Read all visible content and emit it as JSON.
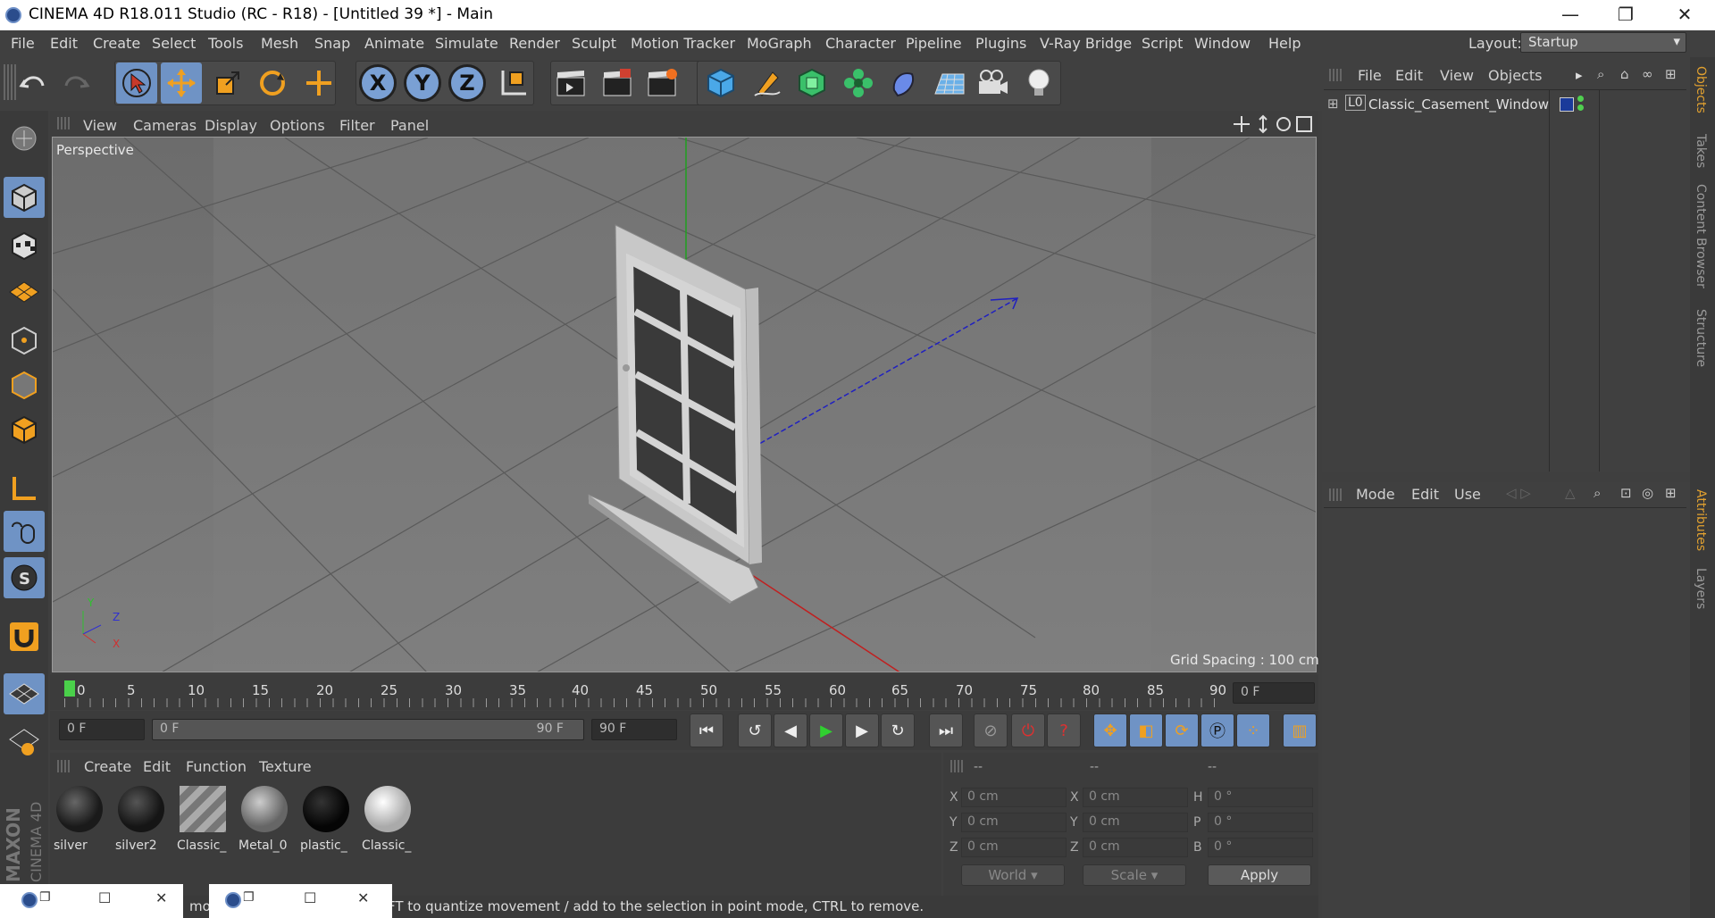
{
  "titlebar": {
    "title": "CINEMA 4D R18.011 Studio (RC - R18) - [Untitled 39 *] - Main",
    "min": "—",
    "max": "❐",
    "close": "✕"
  },
  "menubar": {
    "items": [
      "File",
      "Edit",
      "Create",
      "Select",
      "Tools",
      "Mesh",
      "Snap",
      "Animate",
      "Simulate",
      "Render",
      "Sculpt",
      "Motion Tracker",
      "MoGraph",
      "Character",
      "Pipeline",
      "Plugins",
      "V-Ray Bridge",
      "Script",
      "Window",
      "Help"
    ],
    "layout_label": "Layout:",
    "layout_value": "Startup"
  },
  "toolbar": {
    "x_label": "X",
    "y_label": "Y",
    "z_label": "Z"
  },
  "viewport": {
    "menu": [
      "View",
      "Cameras",
      "Display",
      "Options",
      "Filter",
      "Panel"
    ],
    "camera_label": "Perspective",
    "grid_spacing": "Grid Spacing : 100 cm",
    "axis_y": "Y",
    "axis_z": "Z",
    "axis_x": "X"
  },
  "timeline": {
    "ticks": [
      "0",
      "5",
      "10",
      "15",
      "20",
      "25",
      "30",
      "35",
      "40",
      "45",
      "50",
      "55",
      "60",
      "65",
      "70",
      "75",
      "80",
      "85",
      "90"
    ],
    "current_frame": "0 F",
    "start_frame": "0 F",
    "range_start": "0 F",
    "range_end": "90 F",
    "end_frame": "90 F"
  },
  "materials": {
    "menu": [
      "Create",
      "Edit",
      "Function",
      "Texture"
    ],
    "items": [
      {
        "name": "silver",
        "color": "#1a1a1a"
      },
      {
        "name": "silver2",
        "color": "#151515"
      },
      {
        "name": "Classic_",
        "color": "stripes"
      },
      {
        "name": "Metal_0",
        "color": "#8a8a8a"
      },
      {
        "name": "plastic_",
        "color": "#050505"
      },
      {
        "name": "Classic_",
        "color": "#d8d8d8"
      }
    ]
  },
  "coordinates": {
    "header": [
      "--",
      "--",
      "--"
    ],
    "rows": [
      {
        "pl": "X",
        "pv": "0 cm",
        "sl": "X",
        "sv": "0 cm",
        "rl": "H",
        "rv": "0 °"
      },
      {
        "pl": "Y",
        "pv": "0 cm",
        "sl": "Y",
        "sv": "0 cm",
        "rl": "P",
        "rv": "0 °"
      },
      {
        "pl": "Z",
        "pv": "0 cm",
        "sl": "Z",
        "sv": "0 cm",
        "rl": "B",
        "rv": "0 °"
      }
    ],
    "mode": "World",
    "scale": "Scale",
    "apply": "Apply"
  },
  "objects_panel": {
    "menu": [
      "File",
      "Edit",
      "View",
      "Objects"
    ],
    "objects": [
      {
        "name": "Classic_Casement_Window",
        "layer": "L0"
      }
    ]
  },
  "attributes_panel": {
    "menu": [
      "Mode",
      "Edit",
      "Use"
    ]
  },
  "side_tabs": [
    "Objects",
    "Takes",
    "Content Browser",
    "Structure",
    "Attributes",
    "Layers"
  ],
  "status": {
    "text": "FT to quantize movement / add to the selection in point mode, CTRL to remove.",
    "prefix": "mo"
  },
  "brand": "MAXON CINEMA 4D"
}
